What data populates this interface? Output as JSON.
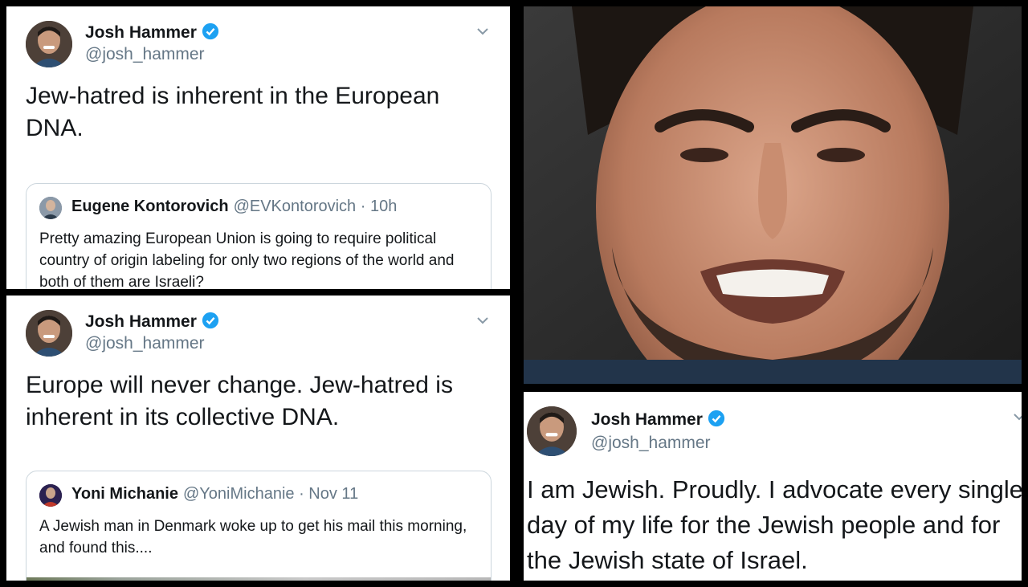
{
  "tweets": [
    {
      "author_name": "Josh Hammer",
      "author_handle": "@josh_hammer",
      "text": "Jew-hatred is inherent in the European DNA.",
      "quote": {
        "author_name": "Eugene Kontorovich",
        "author_handle": "@EVKontorovich",
        "time": "· 10h",
        "text": "Pretty amazing European Union is going to require political  country of origin labeling for only two regions of the world and both of them are Israeli?"
      }
    },
    {
      "author_name": "Josh Hammer",
      "author_handle": "@josh_hammer",
      "text": "Europe will never change. Jew-hatred is inherent in its collective DNA.",
      "quote": {
        "author_name": "Yoni Michanie",
        "author_handle": "@YoniMichanie",
        "time": "· Nov 11",
        "text": "A Jewish man in Denmark woke up to get his mail this morning, and found this...."
      }
    },
    {
      "author_name": "Josh Hammer",
      "author_handle": "@josh_hammer",
      "text": "I am Jewish. Proudly. I advocate every single day of my life for the Jewish people and for the Jewish state of Israel."
    }
  ],
  "colors": {
    "verified": "#1da1f2",
    "name": "#14171a",
    "handle": "#657786",
    "border": "#ccd6dd",
    "background": "#000000"
  },
  "icons": [
    "verified-badge-icon",
    "chevron-down-icon",
    "avatar"
  ]
}
